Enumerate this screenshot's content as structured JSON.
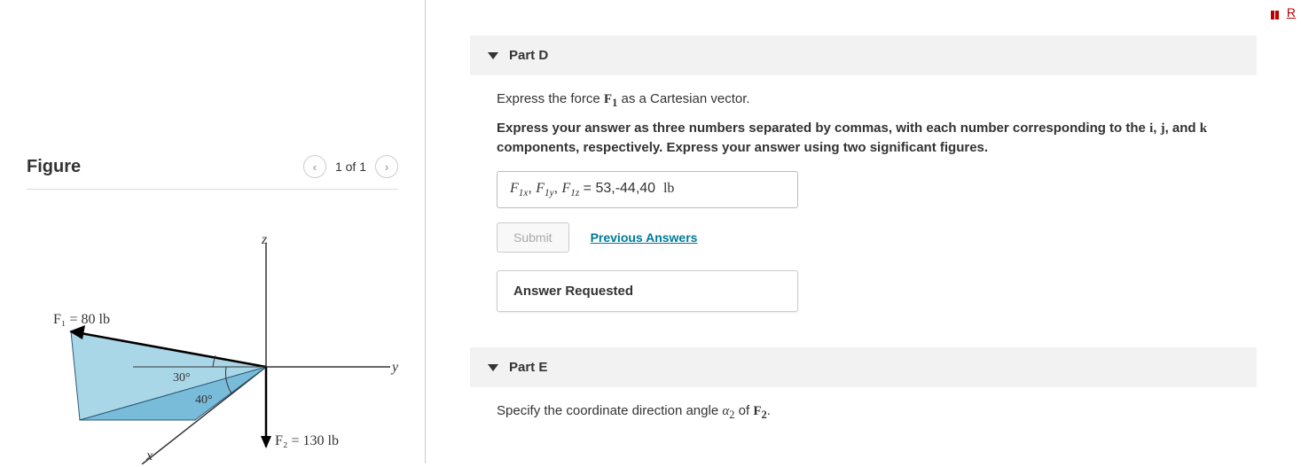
{
  "top_link": {
    "text": "R"
  },
  "figure": {
    "title": "Figure",
    "pager": {
      "text": "1 of 1"
    },
    "labels": {
      "z": "z",
      "y": "y",
      "x": "x",
      "F1": "F₁ = 80 lb",
      "F2": "F₂ = 130 lb",
      "angle30": "30°",
      "angle40": "40°"
    }
  },
  "partD": {
    "title": "Part D",
    "prompt_prefix": "Express the force ",
    "prompt_vec": "F",
    "prompt_vec_sub": "1",
    "prompt_suffix": " as a Cartesian vector.",
    "instruction_prefix": "Express your answer as three numbers separated by commas, with each number corresponding to the ",
    "i": "i",
    "j": "j",
    "k": "k",
    "instruction_suffix": " components, respectively. Express your answer using two significant figures.",
    "answer": {
      "label_F": "F",
      "sub1x": "1x",
      "sub1y": "1y",
      "sub1z": "1z",
      "eq": " = ",
      "value": "53,-44,40",
      "unit": "lb"
    },
    "submit": "Submit",
    "prev": "Previous Answers",
    "status": "Answer Requested"
  },
  "partE": {
    "title": "Part E",
    "prompt_prefix": "Specify the coordinate direction angle ",
    "alpha": "α",
    "alpha_sub": "2",
    "prompt_mid": " of ",
    "vec": "F",
    "vec_sub": "2",
    "prompt_suffix": "."
  }
}
